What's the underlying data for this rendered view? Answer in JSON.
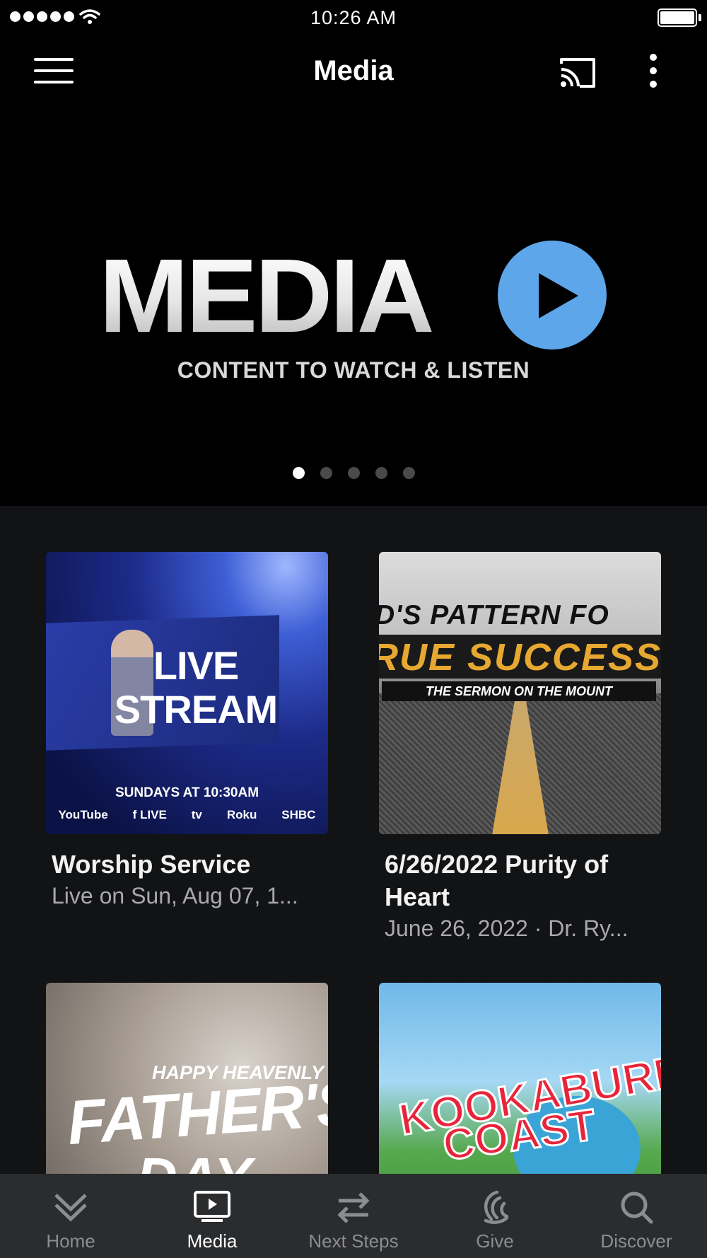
{
  "status_bar": {
    "time": "10:26 AM"
  },
  "header": {
    "title": "Media"
  },
  "hero": {
    "logo_text": "MEDIA",
    "tagline": "CONTENT TO WATCH & LISTEN",
    "slide_count": 5,
    "active_slide": 1,
    "play_color": "#5ea6ea"
  },
  "items": [
    {
      "title": "Worship Service",
      "subtitle": "Live on Sun, Aug 07, 1...",
      "thumb": {
        "line1": "LIVE",
        "line2": "STREAM",
        "schedule": "SUNDAYS AT 10:30AM",
        "brands": [
          "YouTube",
          "f LIVE",
          "tv",
          "Roku",
          "SHBC"
        ]
      }
    },
    {
      "title": "6/26/2022 Purity of Heart",
      "subtitle": "June 26, 2022 · Dr. Ry...",
      "thumb": {
        "line1": "D'S PATTERN FO",
        "line2": "RUE SUCCESS",
        "line3": "THE SERMON ON THE MOUNT"
      }
    },
    {
      "title": "",
      "subtitle": "",
      "thumb": {
        "line1": "HAPPY HEAVENLY",
        "line2": "FATHER'S",
        "line3": "DAY"
      }
    },
    {
      "title": "",
      "subtitle": "",
      "thumb": {
        "line1": "KOOKABURRA",
        "line2": "COAST"
      }
    }
  ],
  "tabs": [
    {
      "label": "Home",
      "icon": "double-chevron-down-icon",
      "active": false
    },
    {
      "label": "Media",
      "icon": "tv-play-icon",
      "active": true
    },
    {
      "label": "Next Steps",
      "icon": "swap-arrows-icon",
      "active": false
    },
    {
      "label": "Give",
      "icon": "give-swirl-icon",
      "active": false
    },
    {
      "label": "Discover",
      "icon": "search-icon",
      "active": false
    }
  ]
}
